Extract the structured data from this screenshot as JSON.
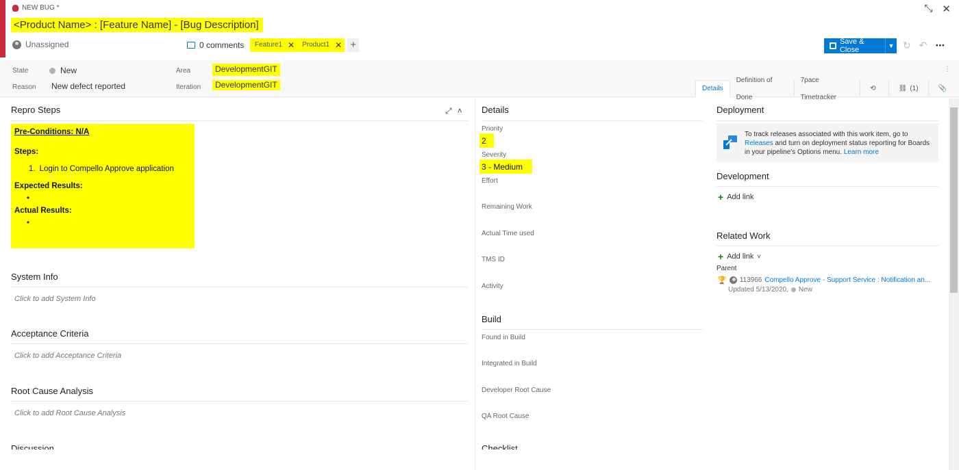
{
  "header": {
    "work_item_type": "NEW BUG *",
    "title": "<Product Name> : [Feature Name] - [Bug Description]",
    "assignee": "Unassigned",
    "comments": "0 comments",
    "tags": [
      {
        "label": "Feature1"
      },
      {
        "label": "Product1"
      }
    ],
    "add_tag": "+",
    "save_label": "Save & Close"
  },
  "fields": {
    "state_label": "State",
    "state_value": "New",
    "reason_label": "Reason",
    "reason_value": "New defect reported",
    "area_label": "Area",
    "area_value": "DevelopmentGIT",
    "iteration_label": "Iteration",
    "iteration_value": "DevelopmentGIT"
  },
  "tabs": [
    {
      "label": "Details"
    },
    {
      "label": "Definition of Done"
    },
    {
      "label": "7pace Timetracker"
    },
    {
      "label": ""
    },
    {
      "label": "(1)"
    },
    {
      "label": ""
    }
  ],
  "left": {
    "repro_title": "Repro Steps",
    "repro": {
      "preconditions": "Pre-Conditions: N/A",
      "steps_label": "Steps:",
      "step1_num": "1.",
      "step1": "Login to Compello Approve application",
      "expected_label": "Expected Results:",
      "actual_label": "Actual Results:",
      "bullet": "•"
    },
    "sysinfo_title": "System Info",
    "sysinfo_placeholder": "Click to add System Info",
    "acceptance_title": "Acceptance Criteria",
    "acceptance_placeholder": "Click to add Acceptance Criteria",
    "rca_title": "Root Cause Analysis",
    "rca_placeholder": "Click to add Root Cause Analysis",
    "discussion_title": "Discussion"
  },
  "details": {
    "title": "Details",
    "priority_label": "Priority",
    "priority_value": "2",
    "severity_label": "Severity",
    "severity_value": "3 - Medium",
    "effort_label": "Effort",
    "remaining_label": "Remaining Work",
    "actual_time_label": "Actual Time used",
    "tms_label": "TMS ID",
    "activity_label": "Activity",
    "build_title": "Build",
    "found_label": "Found in Build",
    "integrated_label": "Integrated in Build",
    "dev_root_label": "Developer Root Cause",
    "qa_root_label": "QA Root Cause",
    "checklist_title": "Checklist"
  },
  "right": {
    "deployment_title": "Deployment",
    "deploy_text_1": "To track releases associated with this work item, go to ",
    "deploy_link_releases": "Releases",
    "deploy_text_2": " and turn on deployment status reporting for Boards in your pipeline's Options menu. ",
    "deploy_link_learn": "Learn more",
    "development_title": "Development",
    "add_link": "Add link",
    "related_title": "Related Work",
    "related_add_link": "Add link",
    "parent_label": "Parent",
    "parent_id": "113966",
    "parent_title": "Compello Approve - Support Service : Notification an...",
    "parent_updated": "Updated 5/13/2020,",
    "parent_state": "New"
  },
  "colors": {
    "accent": "#0078d4",
    "bug_red": "#cc293d",
    "highlight": "#ffff00"
  }
}
